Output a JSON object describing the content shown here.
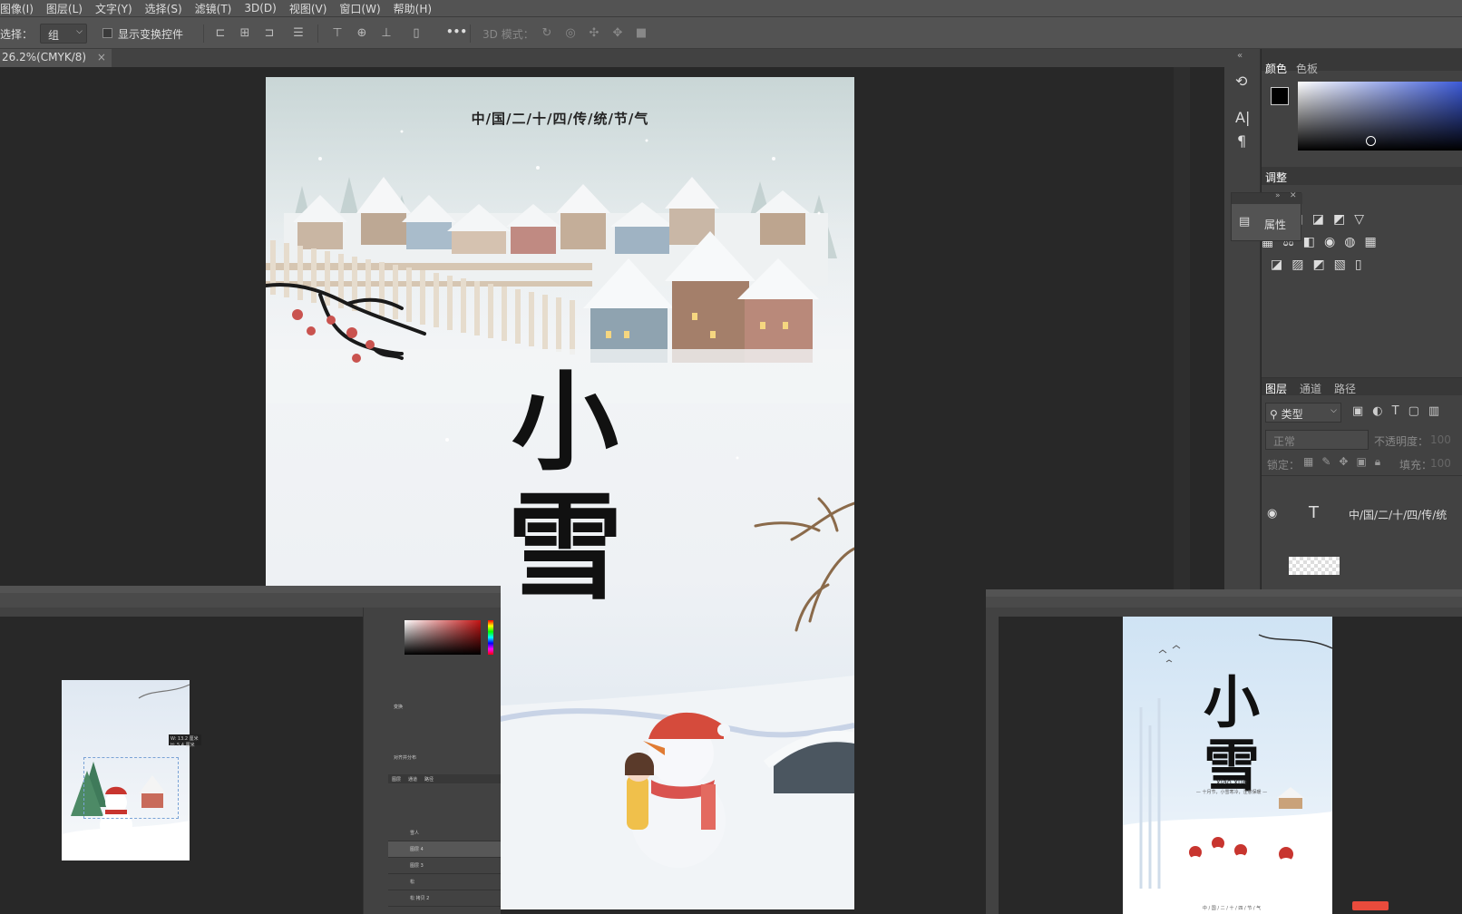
{
  "menubar": {
    "items": [
      "图像(I)",
      "图层(L)",
      "文字(Y)",
      "选择(S)",
      "滤镜(T)",
      "3D(D)",
      "视图(V)",
      "窗口(W)",
      "帮助(H)"
    ]
  },
  "options": {
    "select_label": "选择：",
    "select_value": "组",
    "transform_checkbox_label": "显示变换控件",
    "mode3d_label": "3D 模式：",
    "more_label": "•••"
  },
  "tab": {
    "title": "26.2%(CMYK/8)",
    "close": "×"
  },
  "poster": {
    "subtitle": "中/国/二/十/四/传/统/节/气",
    "title_char1": "小",
    "title_char2": "雪"
  },
  "side_strip": {
    "char_icon": "A|",
    "para_icon": "¶",
    "properties_label": "属性"
  },
  "color_panel": {
    "tab_color": "颜色",
    "tab_swatches": "色板"
  },
  "adjust_panel": {
    "tab": "调整",
    "heading": "调整"
  },
  "layers_panel": {
    "tab_layers": "图层",
    "tab_channels": "通道",
    "tab_paths": "路径",
    "filter_value": "类型",
    "blend_mode": "正常",
    "opacity_label": "不透明度：",
    "opacity_value": "100",
    "lock_label": "锁定：",
    "fill_label": "填充：",
    "fill_value": "100",
    "layer1_name": "中/国/二/十/四/传/统"
  },
  "subwindow_left": {
    "layers": [
      "雪人",
      "图层 4",
      "图层 3",
      "松",
      "松 拷贝 2"
    ],
    "panel_tabs": [
      "图层",
      "通道",
      "路径"
    ],
    "transform_label": "变换",
    "align_label": "对齐并分布",
    "info_w": "W: 13.2 厘米",
    "info_h": "H: 5.4 厘米"
  },
  "subwindow_right": {
    "poster_title": "小雪",
    "poster_pinyin": "xiao  xue",
    "poster_subtitle": "— 十月节，小雪寒冷，注意保暖 —",
    "poster_bottom": "中 / 国 / 二 / 十 / 四 / 节 / 气"
  },
  "colors": {
    "app_bg": "#282828",
    "panel_bg": "#424242",
    "bar_bg": "#535353",
    "accent_blue": "#3d5bd8"
  }
}
